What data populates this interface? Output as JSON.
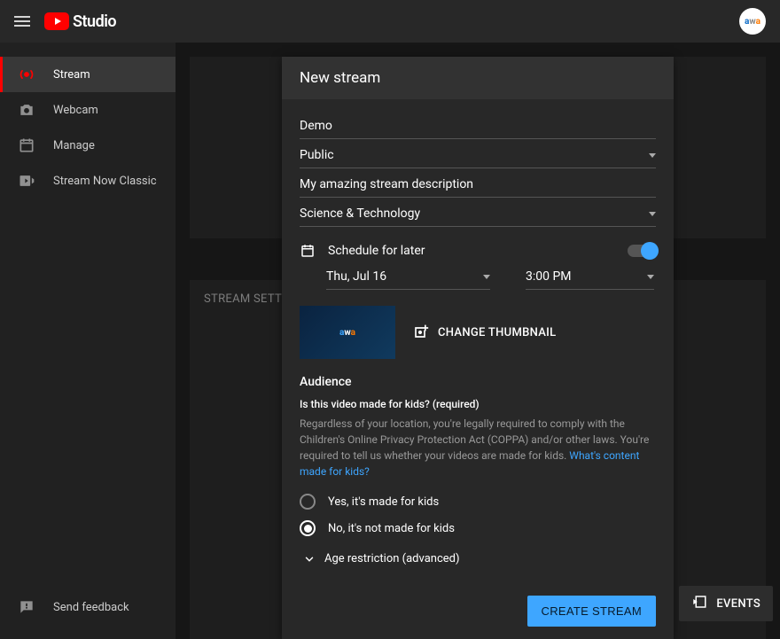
{
  "header": {
    "studio_text": "Studio"
  },
  "sidebar": {
    "items": [
      {
        "label": "Stream",
        "active": true
      },
      {
        "label": "Webcam",
        "active": false
      },
      {
        "label": "Manage",
        "active": false
      },
      {
        "label": "Stream Now Classic",
        "active": false
      }
    ],
    "feedback_label": "Send feedback"
  },
  "bg": {
    "stream_settings_label": "STREAM SETTINGS"
  },
  "dialog": {
    "title": "New stream",
    "title_value": "Demo",
    "visibility_value": "Public",
    "description_value": "My amazing stream description",
    "category_value": "Science & Technology",
    "schedule_label": "Schedule for later",
    "schedule_on": true,
    "date_value": "Thu, Jul 16",
    "time_value": "3:00 PM",
    "change_thumb_label": "CHANGE THUMBNAIL",
    "audience_heading": "Audience",
    "kids_question": "Is this video made for kids? (required)",
    "kids_desc": "Regardless of your location, you're legally required to comply with the Children's Online Privacy Protection Act (COPPA) and/or other laws. You're required to tell us whether your videos are made for kids. ",
    "kids_link": "What's content made for kids?",
    "radio_yes": "Yes, it's made for kids",
    "radio_no": "No, it's not made for kids",
    "kids_selection": "no",
    "age_restriction_label": "Age restriction (advanced)",
    "create_button": "CREATE STREAM"
  },
  "events_button": "EVENTS"
}
